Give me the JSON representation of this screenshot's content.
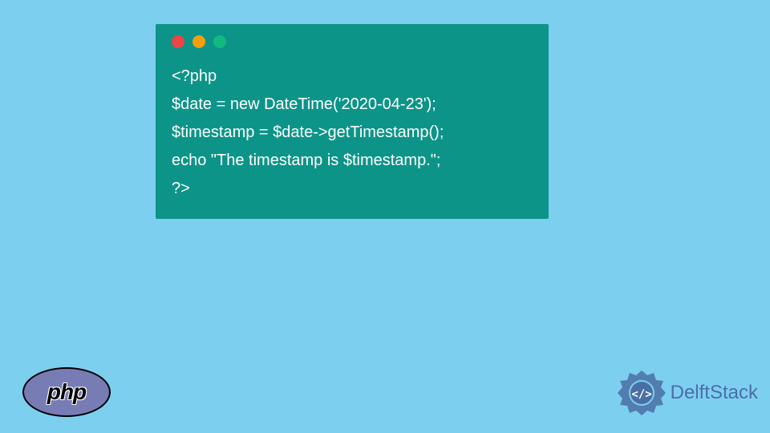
{
  "code": {
    "line1": "<?php",
    "line2": "$date = new DateTime('2020-04-23');",
    "line3": "$timestamp = $date->getTimestamp();",
    "line4": "echo \"The timestamp is $timestamp.\";",
    "line5": "?>"
  },
  "logos": {
    "php_text": "php",
    "delftstack_text": "DelftStack"
  }
}
